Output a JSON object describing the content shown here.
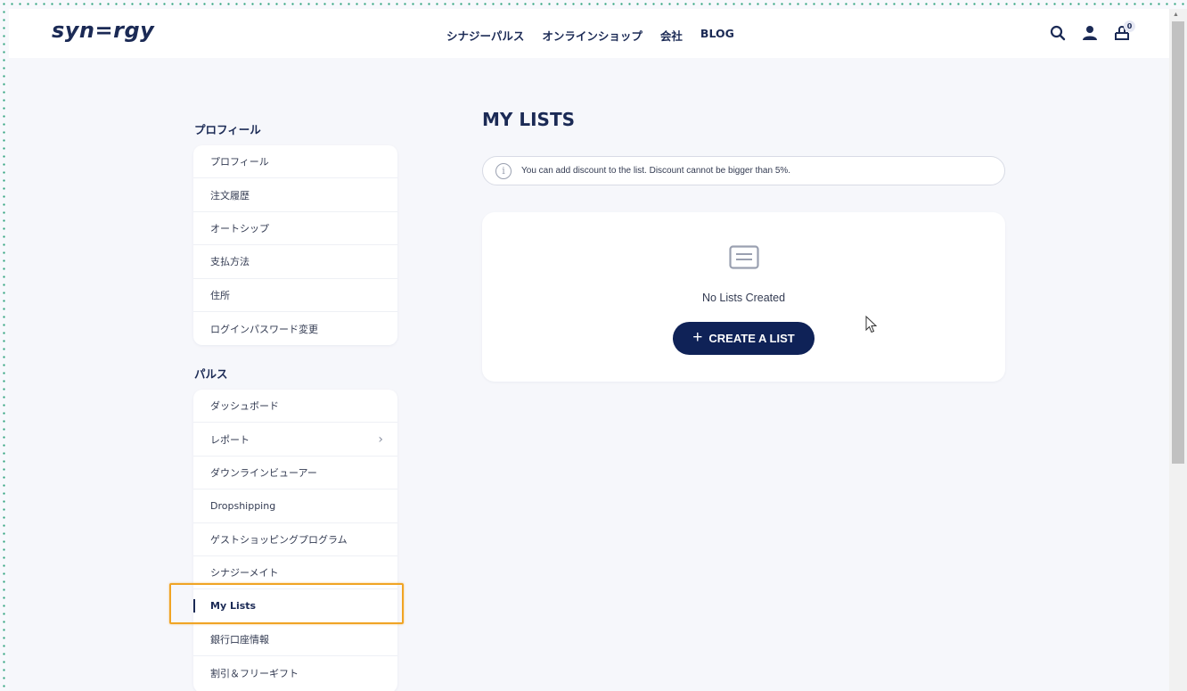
{
  "header": {
    "logo": "syn=rgy",
    "nav": [
      "シナジーパルス",
      "オンラインショップ",
      "会社",
      "BLOG"
    ],
    "cart_count": "0"
  },
  "sidebar": {
    "profile_heading": "プロフィール",
    "profile_items": [
      "プロフィール",
      "注文履歴",
      "オートシップ",
      "支払方法",
      "住所",
      "ログインパスワード変更"
    ],
    "pulse_heading": "パルス",
    "pulse_items": [
      "ダッシュボード",
      "レポート",
      "ダウンラインビューアー",
      "Dropshipping",
      "ゲストショッピングプログラム",
      "シナジーメイト",
      "My Lists",
      "銀行口座情報",
      "割引＆フリーギフト"
    ],
    "active_item": "My Lists"
  },
  "main": {
    "title": "MY LISTS",
    "notice": "You can add discount to the list. Discount cannot be bigger than 5%.",
    "empty_text": "No Lists Created",
    "create_button": "CREATE A LIST"
  },
  "colors": {
    "brand_navy": "#0f2257",
    "highlight": "#f0a424",
    "page_bg": "#f6f7fb"
  },
  "icons": [
    "search-icon",
    "user-icon",
    "cart-icon",
    "info-icon",
    "list-icon",
    "chevron-right-icon",
    "plus-icon",
    "mouse-pointer-icon"
  ]
}
